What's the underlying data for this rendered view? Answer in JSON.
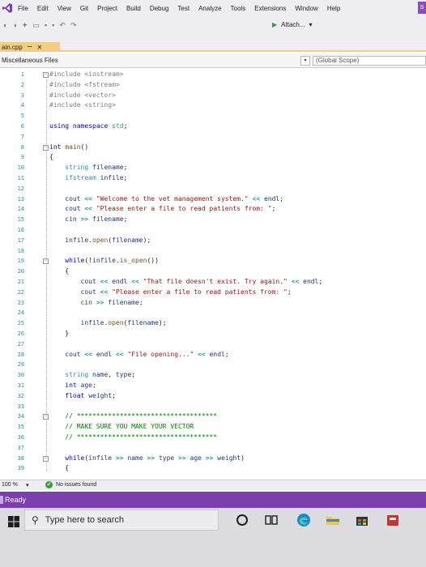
{
  "menubar": {
    "items": [
      "File",
      "Edit",
      "View",
      "Git",
      "Project",
      "Build",
      "Debug",
      "Test",
      "Analyze",
      "Tools",
      "Extensions",
      "Window",
      "Help"
    ],
    "user_badge": "S"
  },
  "toolbar": {
    "attach_label": "Attach...",
    "attach_dropdown": "▾"
  },
  "tab": {
    "filename": "ain.cpp",
    "pin": "ꟷ",
    "close": "✕"
  },
  "navbar": {
    "project": "Miscellaneous Files",
    "scope": "(Global Scope)"
  },
  "editor": {
    "line_numbers": [
      "1",
      "2",
      "3",
      "4",
      "5",
      "6",
      "7",
      "8",
      "9",
      "10",
      "11",
      "12",
      "13",
      "14",
      "15",
      "16",
      "17",
      "18",
      "19",
      "20",
      "21",
      "22",
      "23",
      "24",
      "25",
      "26",
      "27",
      "28",
      "29",
      "30",
      "31",
      "32",
      "33",
      "34",
      "35",
      "36",
      "37",
      "38",
      "39"
    ],
    "lines": [
      "#include <iostream>",
      "#include <fstream>",
      "#include <vector>",
      "#include <string>",
      "",
      "using namespace std;",
      "",
      "int main()",
      "{",
      "    string filename;",
      "    ifstream infile;",
      "",
      "    cout << \"Welcome to the vet management system.\" << endl;",
      "    cout << \"Please enter a file to read patients from: \";",
      "    cin >> filename;",
      "",
      "    infile.open(filename);",
      "",
      "    while(!infile.is_open())",
      "    {",
      "        cout << endl << \"That file doesn't exist. Try again.\" << endl;",
      "        cout << \"Please enter a file to read patients from: \";",
      "        cin >> filename;",
      "",
      "        infile.open(filename);",
      "    }",
      "",
      "    cout << endl << \"File opening...\" << endl;",
      "",
      "    string name, type;",
      "    int age;",
      "    float weight;",
      "",
      "    // ************************************",
      "    // MAKE SURE YOU MAKE YOUR VECTOR",
      "    // ************************************",
      "",
      "    while(infile >> name >> type >> age >> weight)",
      "    {"
    ]
  },
  "editor_status": {
    "zoom": "100 %",
    "zoom_dropdown": "▾",
    "issues_check": "✔",
    "issues": "No issues found"
  },
  "vs_status": {
    "text": "Ready"
  },
  "taskbar": {
    "search_placeholder": "Type here to search",
    "search_icon": "⚲"
  },
  "colors": {
    "status_bar": "#7a3eaf",
    "tab_active": "#f5cc84",
    "keyword": "#0000ff",
    "string": "#a31515",
    "comment": "#008000",
    "type": "#2b91af"
  }
}
